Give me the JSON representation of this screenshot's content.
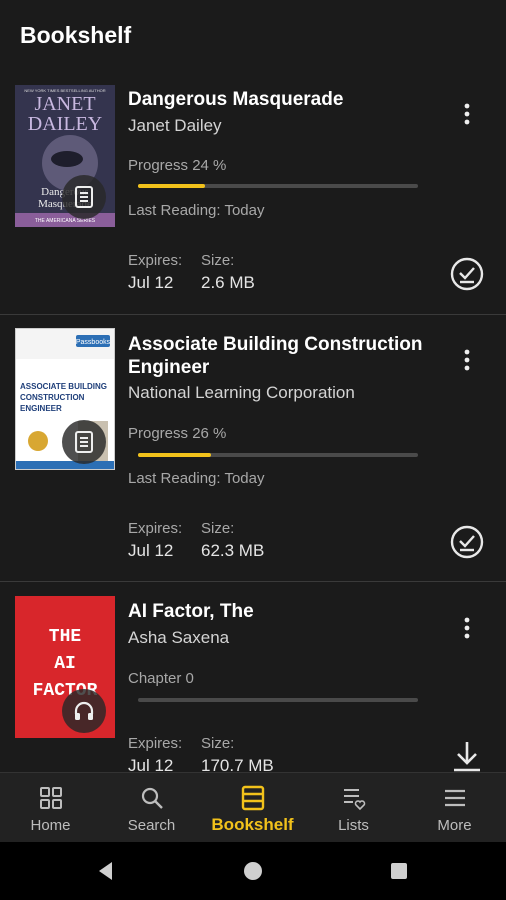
{
  "header": {
    "title": "Bookshelf"
  },
  "books": [
    {
      "title": "Dangerous Masquerade",
      "author": "Janet Dailey",
      "progress_label": "Progress 24 %",
      "progress": 0.24,
      "last_reading": "Last Reading: Today",
      "expires_label": "Expires:",
      "expires": "Jul 12",
      "size_label": "Size:",
      "size": "2.6 MB",
      "cover": {
        "top_text": "NEW YORK TIMES BESTSELLING AUTHOR",
        "author1": "JANET",
        "author2": "DAILEY",
        "title1": "Dangerous",
        "title2": "Masquerade",
        "series": "THE AMERICANA SERIES",
        "bg": "#3b3a55",
        "accent": "#c8b8e0"
      },
      "badge_icon": "document-icon",
      "action_icon": "check-circle-icon"
    },
    {
      "title": "Associate Building Construction Engineer",
      "author": "National Learning Corporation",
      "progress_label": "Progress 26 %",
      "progress": 0.26,
      "last_reading": "Last Reading: Today",
      "expires_label": "Expires:",
      "expires": "Jul 12",
      "size_label": "Size:",
      "size": "62.3 MB",
      "cover": {
        "line1": "ASSOCIATE BUILDING",
        "line2": "CONSTRUCTION",
        "line3": "ENGINEER",
        "brand": "Passbooks",
        "bg": "#ffffff"
      },
      "badge_icon": "document-icon",
      "action_icon": "check-circle-icon"
    },
    {
      "title": "AI Factor, The",
      "author": "Asha Saxena",
      "chapter_label": "Chapter 0",
      "progress": 0,
      "expires_label": "Expires:",
      "expires": "Jul 12",
      "size_label": "Size:",
      "size": "170.7 MB",
      "cover": {
        "word1": "THE",
        "word2": "AI",
        "word3": "FACTOR",
        "bg": "#d8262b"
      },
      "badge_icon": "headphones-icon",
      "action_icon": "download-icon"
    }
  ],
  "nav": [
    {
      "label": "Home",
      "icon": "grid-icon"
    },
    {
      "label": "Search",
      "icon": "search-icon"
    },
    {
      "label": "Bookshelf",
      "icon": "bookshelf-icon",
      "active": true
    },
    {
      "label": "Lists",
      "icon": "list-heart-icon"
    },
    {
      "label": "More",
      "icon": "menu-icon"
    }
  ],
  "colors": {
    "accent": "#f2c21b",
    "background": "#1b1b1b",
    "nav_bg": "#222222"
  }
}
